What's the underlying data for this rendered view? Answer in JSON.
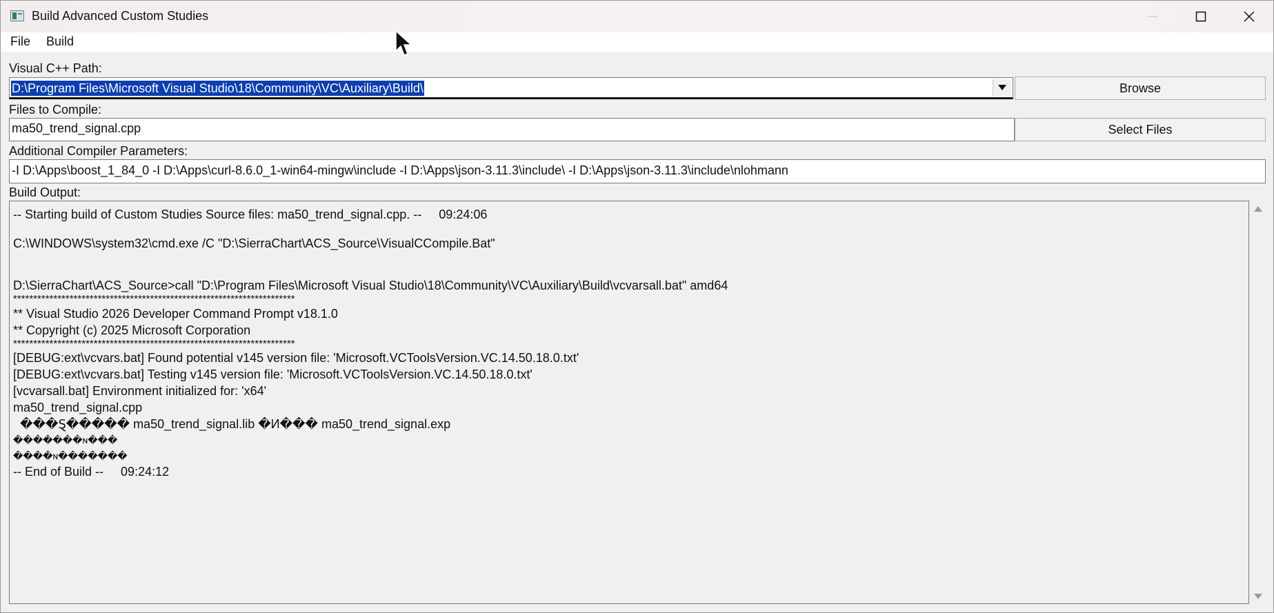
{
  "window": {
    "title": "Build Advanced Custom Studies",
    "icon": "app-window-icon"
  },
  "menu": {
    "file": "File",
    "build": "Build"
  },
  "form": {
    "vc_path_label": "Visual C++ Path:",
    "vc_path_value": "D:\\Program Files\\Microsoft Visual Studio\\18\\Community\\VC\\Auxiliary\\Build\\",
    "browse_label": "Browse",
    "files_label": "Files to Compile:",
    "files_value": "ma50_trend_signal.cpp",
    "select_files_label": "Select Files",
    "params_label": "Additional Compiler Parameters:",
    "params_value": "-I D:\\Apps\\boost_1_84_0 -I D:\\Apps\\curl-8.6.0_1-win64-mingw\\include -I D:\\Apps\\json-3.11.3\\include\\ -I D:\\Apps\\json-3.11.3\\include\\nlohmann",
    "output_label": "Build Output:"
  },
  "output": {
    "lines": [
      "-- Starting build of Custom Studies Source files: ma50_trend_signal.cpp. --     09:24:06",
      "",
      "C:\\WINDOWS\\system32\\cmd.exe /C \"D:\\SierraChart\\ACS_Source\\VisualCCompile.Bat\"",
      "",
      "",
      "D:\\SierraChart\\ACS_Source>call \"D:\\Program Files\\Microsoft Visual Studio\\18\\Community\\VC\\Auxiliary\\Build\\vcvarsall.bat\" amd64",
      "**********************************************************************",
      "** Visual Studio 2026 Developer Command Prompt v18.1.0",
      "** Copyright (c) 2025 Microsoft Corporation",
      "**********************************************************************",
      "[DEBUG:ext\\vcvars.bat] Found potential v145 version file: 'Microsoft.VCToolsVersion.VC.14.50.18.0.txt'",
      "[DEBUG:ext\\vcvars.bat] Testing v145 version file: 'Microsoft.VCToolsVersion.VC.14.50.18.0.txt'",
      "[vcvarsall.bat] Environment initialized for: 'x64'",
      "ma50_trend_signal.cpp",
      "  ���Ȿ����� ma50_trend_signal.lib �И��� ma50_trend_signal.exp",
      "�������ɴ���",
      "����ɴ�������",
      "-- End of Build --     09:24:12"
    ]
  },
  "colors": {
    "selection": "#0a3fb8",
    "window_bg": "#f0f0f0",
    "titlebar_bg": "#f5efef"
  }
}
